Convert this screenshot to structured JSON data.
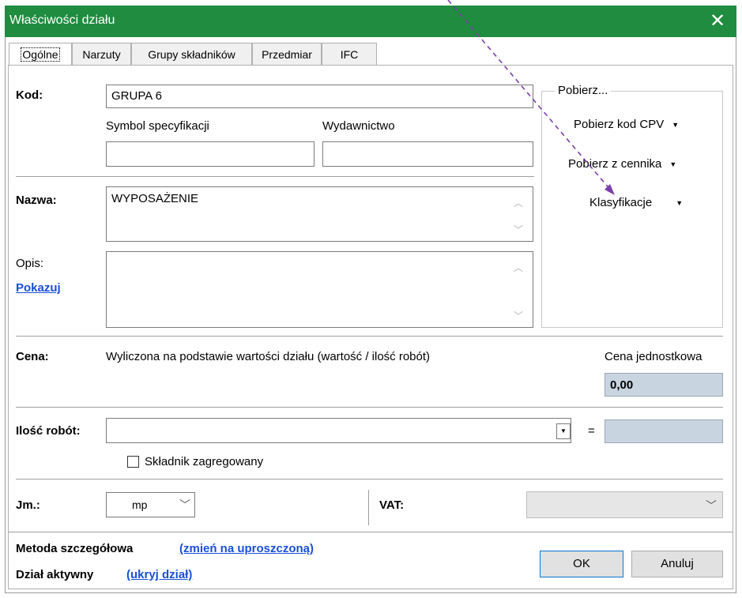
{
  "window": {
    "title": "Właściwości działu",
    "close_glyph": "✕"
  },
  "tabs": [
    {
      "label": "Ogólne"
    },
    {
      "label": "Narzuty"
    },
    {
      "label": "Grupy składników"
    },
    {
      "label": "Przedmiar"
    },
    {
      "label": "IFC"
    }
  ],
  "fields": {
    "kod_label": "Kod:",
    "kod_value": "GRUPA 6",
    "symbol_label": "Symbol specyfikacji",
    "symbol_value": "",
    "wydawnictwo_label": "Wydawnictwo",
    "wydawnictwo_value": "",
    "nazwa_label": "Nazwa:",
    "nazwa_value": "WYPOSAŻENIE",
    "opis_label": "Opis:",
    "opis_link": "Pokazuj",
    "opis_value": "",
    "cena_label": "Cena:",
    "cena_desc": "Wyliczona na podstawie wartości działu (wartość / ilość robót)",
    "cena_jedn_label": "Cena jednostkowa",
    "cena_jedn_value": "0,00",
    "ilosc_label": "Ilość robót:",
    "ilosc_value": "",
    "equals": "=",
    "ilosc_result": "",
    "skladnik_label": "Składnik zagregowany",
    "skladnik_checked": false,
    "jm_label": "Jm.:",
    "jm_value": "mp",
    "vat_label": "VAT:",
    "vat_value": ""
  },
  "pobierz": {
    "group_title": "Pobierz...",
    "items": [
      {
        "label": "Pobierz kod CPV"
      },
      {
        "label": "Pobierz z cennika"
      },
      {
        "label": "Klasyfikacje"
      }
    ]
  },
  "footer": {
    "metoda_label": "Metoda szczegółowa",
    "metoda_link": "(zmień na uproszczoną)",
    "dzial_label": "Dział aktywny",
    "dzial_link": "(ukryj dział)",
    "ok": "OK",
    "cancel": "Anuluj"
  },
  "colors": {
    "titlebar": "#1f8c3f",
    "link": "#1a4fd6",
    "annotation_arrow": "#7b3fa8"
  }
}
